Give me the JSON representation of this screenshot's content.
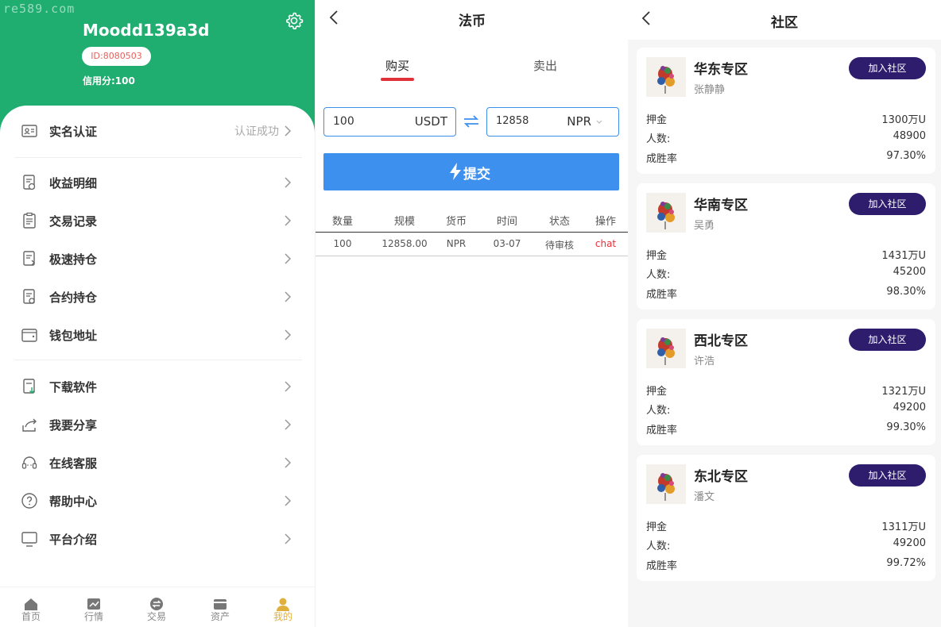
{
  "watermark": "re589.com",
  "profile": {
    "username": "Moodd139a3d",
    "id_label": "ID:8080503",
    "credit": "信用分:100"
  },
  "menu": {
    "items": [
      {
        "label": "实名认证",
        "status": "认证成功",
        "icon": "id-card-icon"
      },
      {
        "label": "收益明细",
        "icon": "income-doc-icon"
      },
      {
        "label": "交易记录",
        "icon": "clipboard-icon"
      },
      {
        "label": "极速持仓",
        "icon": "fast-position-icon"
      },
      {
        "label": "合约持仓",
        "icon": "contract-position-icon"
      },
      {
        "label": "钱包地址",
        "icon": "wallet-icon"
      },
      {
        "label": "下载软件",
        "icon": "download-icon"
      },
      {
        "label": "我要分享",
        "icon": "share-icon"
      },
      {
        "label": "在线客服",
        "icon": "headset-icon"
      },
      {
        "label": "帮助中心",
        "icon": "help-icon"
      },
      {
        "label": "平台介绍",
        "icon": "monitor-icon"
      }
    ]
  },
  "tabbar": {
    "items": [
      {
        "label": "首页",
        "icon": "home-icon"
      },
      {
        "label": "行情",
        "icon": "chart-icon"
      },
      {
        "label": "交易",
        "icon": "exchange-icon"
      },
      {
        "label": "资产",
        "icon": "asset-icon"
      },
      {
        "label": "我的",
        "icon": "user-icon"
      }
    ],
    "active": "我的"
  },
  "fiat": {
    "title": "法币",
    "tabs": [
      "购买",
      "卖出"
    ],
    "active_tab": "购买",
    "amount": "100",
    "amount_unit": "USDT",
    "converted": "12858",
    "converted_unit": "NPR",
    "submit_label": "提交",
    "table": {
      "headers": [
        "数量",
        "规模",
        "货币",
        "时间",
        "状态",
        "操作"
      ],
      "rows": [
        [
          "100",
          "12858.00",
          "NPR",
          "03-07",
          "待审核",
          "chat"
        ]
      ]
    }
  },
  "community": {
    "title": "社区",
    "join_label": "加入社区",
    "deposit_label": "押金",
    "members_label": "人数:",
    "winrate_label": "成胜率",
    "cards": [
      {
        "name": "华东专区",
        "leader": "张静静",
        "deposit": "1300万U",
        "members": "48900",
        "winrate": "97.30%"
      },
      {
        "name": "华南专区",
        "leader": "吴勇",
        "deposit": "1431万U",
        "members": "45200",
        "winrate": "98.30%"
      },
      {
        "name": "西北专区",
        "leader": "许浩",
        "deposit": "1321万U",
        "members": "49200",
        "winrate": "99.30%"
      },
      {
        "name": "东北专区",
        "leader": "潘文",
        "deposit": "1311万U",
        "members": "49200",
        "winrate": "99.72%"
      }
    ]
  },
  "colors": {
    "header_green": "#1fad70",
    "accent_blue": "#3d90ee",
    "join_purple": "#2e1d6d",
    "tab_active": "#e0b03c",
    "tab_underline_red": "#e0303a"
  }
}
